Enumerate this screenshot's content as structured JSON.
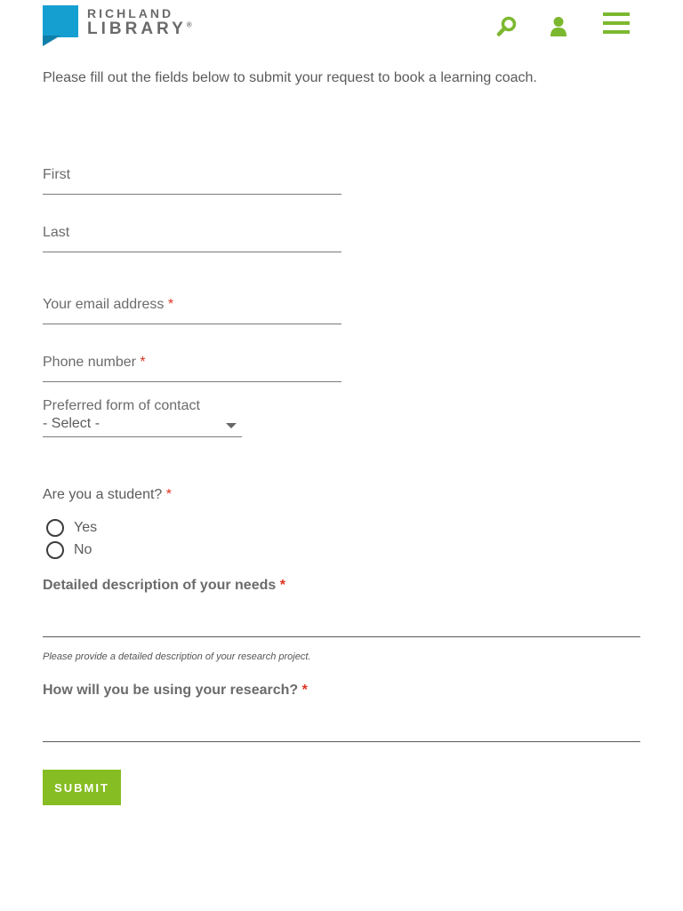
{
  "brand": {
    "name_line1": "RICHLAND",
    "name_line2": "LIBRARY",
    "registered_mark": "®",
    "logo_color": "#159fd0",
    "logo_shadow_color": "#0f7faa",
    "accent_color": "#7cb82f"
  },
  "header": {
    "icons": [
      "search-icon",
      "user-icon",
      "menu-icon"
    ]
  },
  "intro": {
    "text": "Please fill out the fields below to submit your request to book a learning coach."
  },
  "form": {
    "first_name": {
      "label": "First",
      "value": ""
    },
    "last_name": {
      "label": "Last",
      "value": ""
    },
    "email": {
      "label": "Your email address",
      "required_marker": "*",
      "value": ""
    },
    "phone": {
      "label": "Phone number",
      "required_marker": "*",
      "value": ""
    },
    "preferred_contact": {
      "label": "Preferred form of contact",
      "selected": "- Select -"
    },
    "student": {
      "question": "Are you a student?",
      "required_marker": "*",
      "options": [
        {
          "label": "Yes",
          "checked": false
        },
        {
          "label": "No",
          "checked": false
        }
      ]
    },
    "needs": {
      "label": "Detailed description of your needs",
      "required_marker": "*",
      "helper": "Please provide a detailed description of your research project.",
      "value": ""
    },
    "research_use": {
      "label": "How will you be using your research?",
      "required_marker": "*",
      "value": ""
    },
    "submit_label": "SUBMIT",
    "submit_color": "#86bd22",
    "required_color": "#e0331f"
  }
}
